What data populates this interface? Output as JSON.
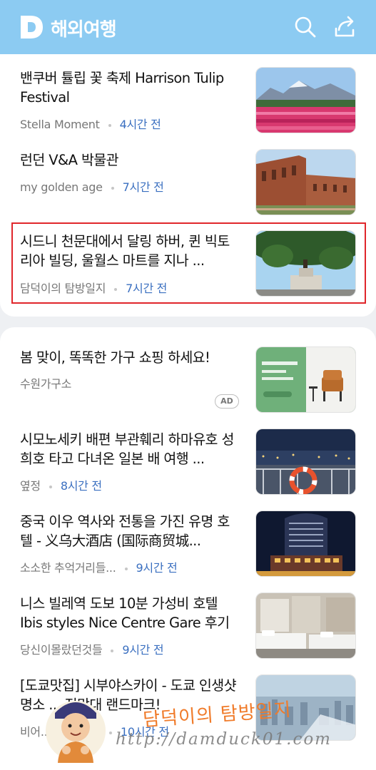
{
  "app": {
    "title": "해외여행",
    "logo": "D",
    "colors": {
      "header": "#8ccbf2",
      "link": "#3a6fc0",
      "highlight": "#e0262b"
    }
  },
  "icons": {
    "logo": "daum-d-logo-icon",
    "search": "search-icon",
    "share": "share-icon"
  },
  "feed1": [
    {
      "title": "밴쿠버 튤립 꽃 축제 Harrison Tulip Festival",
      "source": "Stella Moment",
      "time": "4시간 전"
    },
    {
      "title": "런던 V&A 박물관",
      "source": "my golden age",
      "time": "7시간 전"
    },
    {
      "title": "시드니 천문대에서 달링 하버, 퀸 빅토리아 빌딩, 울월스 마트를 지나 ...",
      "source": "담덕이의 탐방일지",
      "time": "7시간 전"
    }
  ],
  "ad": {
    "title": "봄 맞이, 똑똑한 가구 쇼핑 하세요!",
    "source": "수원가구소",
    "badge": "AD"
  },
  "feed2": [
    {
      "title": "시모노세키 배편 부관훼리 하마유호 성희호 타고 다녀온 일본 배 여행 ...",
      "source": "옆정",
      "time": "8시간 전"
    },
    {
      "title": "중국 이우 역사와 전통을 가진 유명 호텔 - 义乌大酒店 (国际商贸城...",
      "source": "소소한 추억거리들...",
      "time": "9시간 전"
    },
    {
      "title": "니스 빌레역 도보 10분 가성비 호텔 Ibis styles Nice Centre Gare 후기",
      "source": "당신이몰랐던것들",
      "time": "9시간 전"
    },
    {
      "title": "[도쿄맛집] 시부야스카이 - 도쿄 인생샷 명소 ... 전망대 랜드마크!",
      "source": "비어... 맛집 & ...",
      "time": "10시간 전"
    }
  ],
  "watermark": {
    "name": "담덕이의 탐방일지",
    "url": "http://damduck01.com"
  }
}
